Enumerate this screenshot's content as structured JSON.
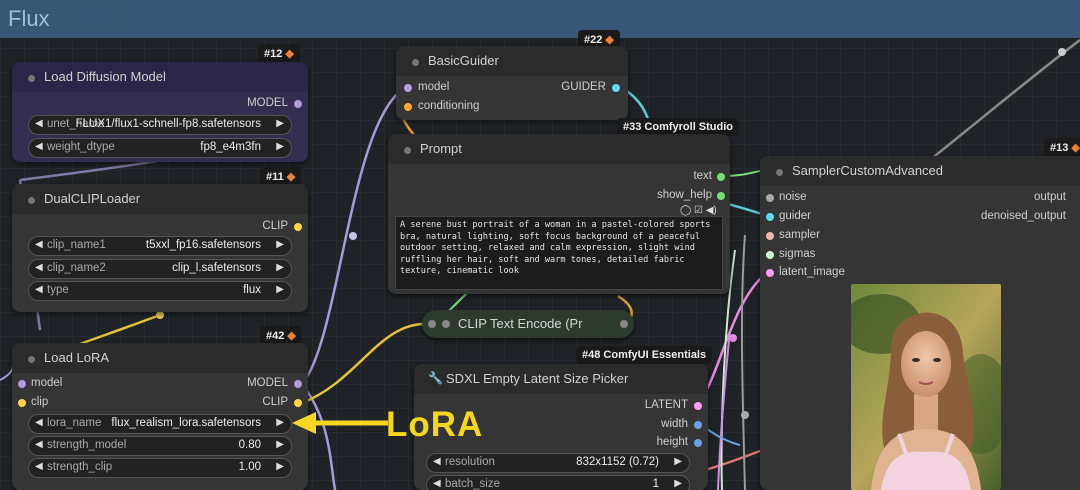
{
  "group": {
    "title": "Flux"
  },
  "nodes": {
    "load_diffusion": {
      "badge": "#12",
      "title": "Load Diffusion Model",
      "outputs": [
        "MODEL"
      ],
      "widgets": [
        {
          "label": "unet_name",
          "value": "FLUX1/flux1-schnell-fp8.safetensors"
        },
        {
          "label": "weight_dtype",
          "value": "fp8_e4m3fn"
        }
      ]
    },
    "dual_clip": {
      "badge": "#11",
      "title": "DualCLIPLoader",
      "outputs": [
        "CLIP"
      ],
      "widgets": [
        {
          "label": "clip_name1",
          "value": "t5xxl_fp16.safetensors"
        },
        {
          "label": "clip_name2",
          "value": "clip_l.safetensors"
        },
        {
          "label": "type",
          "value": "flux"
        }
      ]
    },
    "load_lora": {
      "badge": "#42",
      "title": "Load LoRA",
      "inputs": [
        "model",
        "clip"
      ],
      "outputs": [
        "MODEL",
        "CLIP"
      ],
      "widgets": [
        {
          "label": "lora_name",
          "value": "flux_realism_lora.safetensors"
        },
        {
          "label": "strength_model",
          "value": "0.80"
        },
        {
          "label": "strength_clip",
          "value": "1.00"
        }
      ]
    },
    "basic_guider": {
      "badge": "#22",
      "title": "BasicGuider",
      "inputs": [
        "model",
        "conditioning"
      ],
      "outputs": [
        "GUIDER"
      ]
    },
    "prompt": {
      "tag": "#33 Comfyroll Studio",
      "title": "Prompt",
      "outputs": [
        "text",
        "show_help"
      ],
      "text": "A serene bust portrait of a woman in a pastel-colored sports bra, natural lighting, soft focus background of a peaceful outdoor setting, relaxed and calm expression, slight wind ruffling her hair, soft and warm tones, detailed fabric texture, cinematic look"
    },
    "clip_text_encode": {
      "title": "CLIP Text Encode (Pr"
    },
    "sdxl_latent": {
      "tag": "#48 ComfyUI Essentials",
      "title": "SDXL Empty Latent Size Picker",
      "outputs": [
        "LATENT",
        "width",
        "height"
      ],
      "widgets": [
        {
          "label": "resolution",
          "value": "832x1152 (0.72)"
        },
        {
          "label": "batch_size",
          "value": "1"
        }
      ]
    },
    "sampler": {
      "badge": "#13",
      "title": "SamplerCustomAdvanced",
      "inputs": [
        "noise",
        "guider",
        "sampler",
        "sigmas",
        "latent_image"
      ],
      "outputs": [
        "output",
        "denoised_output"
      ]
    }
  },
  "annotation": {
    "text": "LoRA"
  },
  "colors": {
    "model": "#b39ddb",
    "clip": "#ffd54f",
    "guider": "#66d9e8",
    "conditioning": "#ffa931",
    "latent": "#ff9cf9",
    "int": "#6ba3e6",
    "sigmas": "#cdffcd",
    "sampler": "#ecb4b4",
    "string": "#77dd77",
    "annotation": "#f4d623"
  }
}
